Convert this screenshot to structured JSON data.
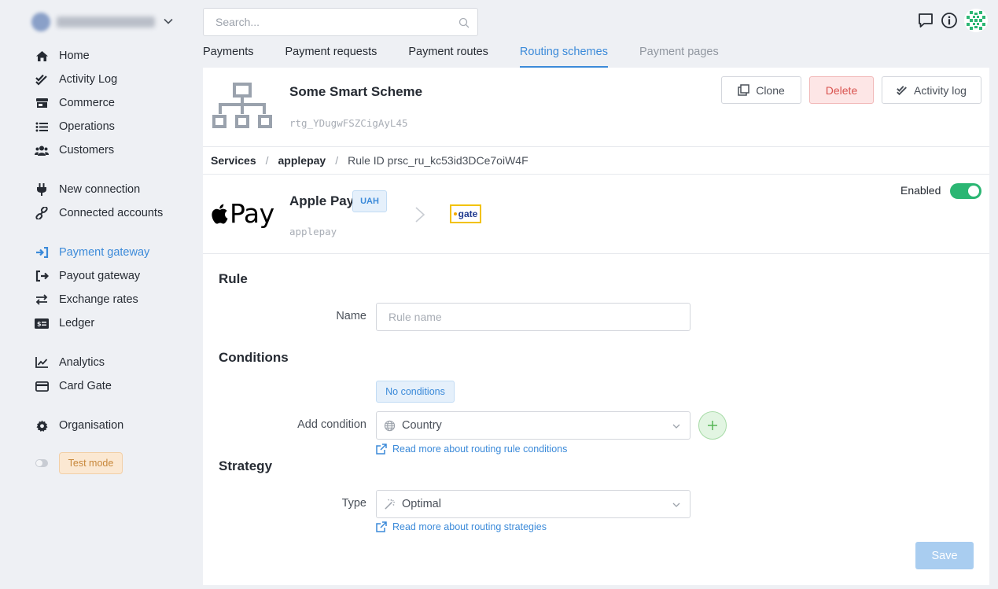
{
  "sidebar": {
    "account": {
      "name": "",
      "caret_icon": "chevron-down-icon"
    },
    "items": [
      {
        "label": "Home",
        "icon": "home-icon"
      },
      {
        "label": "Activity Log",
        "icon": "check-double-icon"
      },
      {
        "label": "Commerce",
        "icon": "store-icon"
      },
      {
        "label": "Operations",
        "icon": "list-icon"
      },
      {
        "label": "Customers",
        "icon": "users-icon"
      },
      {
        "label": "New connection",
        "icon": "plug-icon"
      },
      {
        "label": "Connected accounts",
        "icon": "link-icon"
      },
      {
        "label": "Payment gateway",
        "icon": "sign-in-icon",
        "active": true
      },
      {
        "label": "Payout gateway",
        "icon": "sign-out-icon"
      },
      {
        "label": "Exchange rates",
        "icon": "exchange-icon"
      },
      {
        "label": "Ledger",
        "icon": "money-check-icon"
      },
      {
        "label": "Analytics",
        "icon": "chart-line-icon"
      },
      {
        "label": "Card Gate",
        "icon": "credit-card-icon"
      },
      {
        "label": "Organisation",
        "icon": "gear-icon"
      }
    ],
    "test_mode": {
      "label": "Test mode",
      "enabled": false
    }
  },
  "topbar": {
    "search_placeholder": "Search...",
    "icons": [
      "chat-icon",
      "info-icon",
      "user-pattern-avatar"
    ]
  },
  "tabs": [
    {
      "label": "Payments"
    },
    {
      "label": "Payment requests"
    },
    {
      "label": "Payment routes"
    },
    {
      "label": "Routing schemes",
      "active": true
    },
    {
      "label": "Payment pages",
      "muted": true
    }
  ],
  "scheme": {
    "title": "Some Smart Scheme",
    "id": "rtg_YDugwFSZCigAyL45",
    "icon": "sitemap-icon",
    "actions": {
      "clone": "Clone",
      "delete": "Delete",
      "activity": "Activity log"
    }
  },
  "breadcrumb": {
    "services": "Services",
    "sep": "/",
    "service": "applepay",
    "rule": "Rule ID prsc_ru_kc53id3DCe7oiW4F"
  },
  "service": {
    "logo_text": "Pay",
    "name": "Apple Pay",
    "currency": "UAH",
    "code": "applepay",
    "provider_logo": "gate",
    "enabled_label": "Enabled",
    "enabled": true
  },
  "rule": {
    "section_title": "Rule",
    "name_label": "Name",
    "name_value": "",
    "name_placeholder": "Rule name"
  },
  "conditions": {
    "section_title": "Conditions",
    "empty_badge": "No conditions",
    "add_label": "Add condition",
    "select_value": "Country",
    "link": "Read more about routing rule conditions"
  },
  "strategy": {
    "section_title": "Strategy",
    "type_label": "Type",
    "select_value": "Optimal",
    "link": "Read more about routing strategies"
  },
  "save_label": "Save",
  "colors": {
    "accent": "#3b8ad9",
    "enabled": "#2bb673",
    "delete": "#d9534f",
    "test_mode": "#c7873a"
  }
}
